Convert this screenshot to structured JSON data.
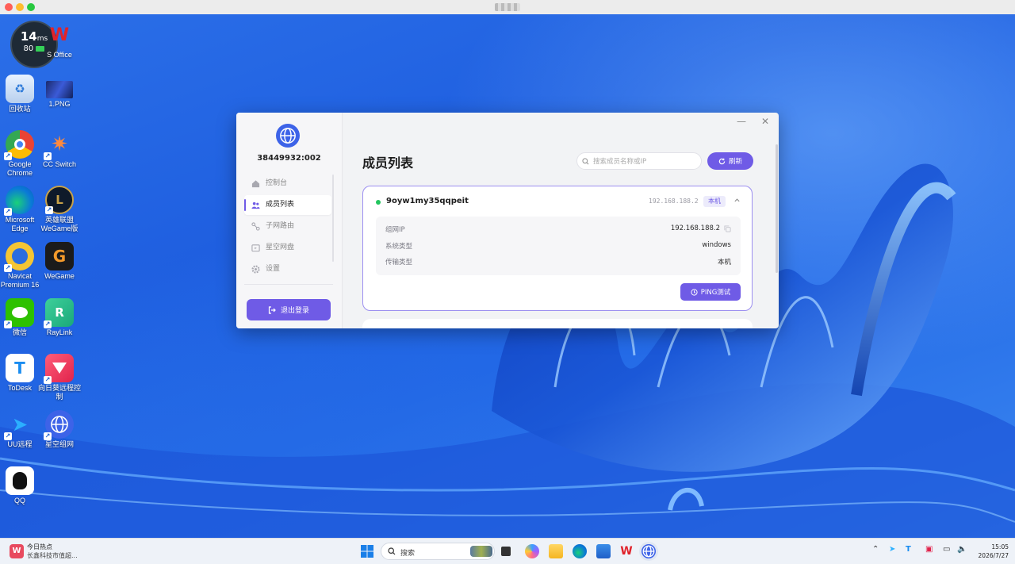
{
  "desktop_icons": [
    {
      "label": "",
      "glyph": ""
    },
    {
      "label": "S Office",
      "glyph": "W"
    },
    {
      "label": "回收站",
      "glyph": "♻"
    },
    {
      "label": "1.PNG",
      "glyph": ""
    },
    {
      "label": "Google Chrome",
      "glyph": ""
    },
    {
      "label": "CC Switch",
      "glyph": "✷"
    },
    {
      "label": "Microsoft Edge",
      "glyph": ""
    },
    {
      "label": "英雄联盟 WeGame版",
      "glyph": "L"
    },
    {
      "label": "Navicat Premium 16",
      "glyph": ""
    },
    {
      "label": "WeGame",
      "glyph": "G"
    },
    {
      "label": "微信",
      "glyph": ""
    },
    {
      "label": "RayLink",
      "glyph": "R"
    },
    {
      "label": "ToDesk",
      "glyph": "T"
    },
    {
      "label": "向日葵远程控制",
      "glyph": ""
    },
    {
      "label": "UU远程",
      "glyph": "U"
    },
    {
      "label": "星空组网",
      "glyph": ""
    },
    {
      "label": "QQ",
      "glyph": ""
    }
  ],
  "perf_widget": {
    "latency": "14",
    "unit": "ms",
    "battery": "80"
  },
  "app": {
    "node_id": "38449932:002",
    "menu": [
      {
        "label": "控制台",
        "icon": "home-icon"
      },
      {
        "label": "成员列表",
        "icon": "users-icon"
      },
      {
        "label": "子网路由",
        "icon": "route-icon"
      },
      {
        "label": "星空网盘",
        "icon": "folder-icon"
      },
      {
        "label": "设置",
        "icon": "gear-icon"
      }
    ],
    "logout_label": "退出登录",
    "page_title": "成员列表",
    "search_placeholder": "搜索成员名称或IP",
    "refresh_label": "刷新",
    "member": {
      "name": "9oyw1my35qqpeit",
      "ip": "192.168.188.2",
      "badge": "本机",
      "details": [
        {
          "key": "组网IP",
          "value": "192.168.188.2"
        },
        {
          "key": "系统类型",
          "value": "windows"
        },
        {
          "key": "传输类型",
          "value": "本机"
        }
      ],
      "ping_label": "PING测试",
      "status_color": "#22c55e"
    },
    "accent_color": "#6f5be6"
  },
  "taskbar": {
    "news_title": "今日热点",
    "news_sub": "长鑫科技市值超...",
    "search_label": "搜索",
    "time": "15:05",
    "date": "2026/7/27"
  }
}
